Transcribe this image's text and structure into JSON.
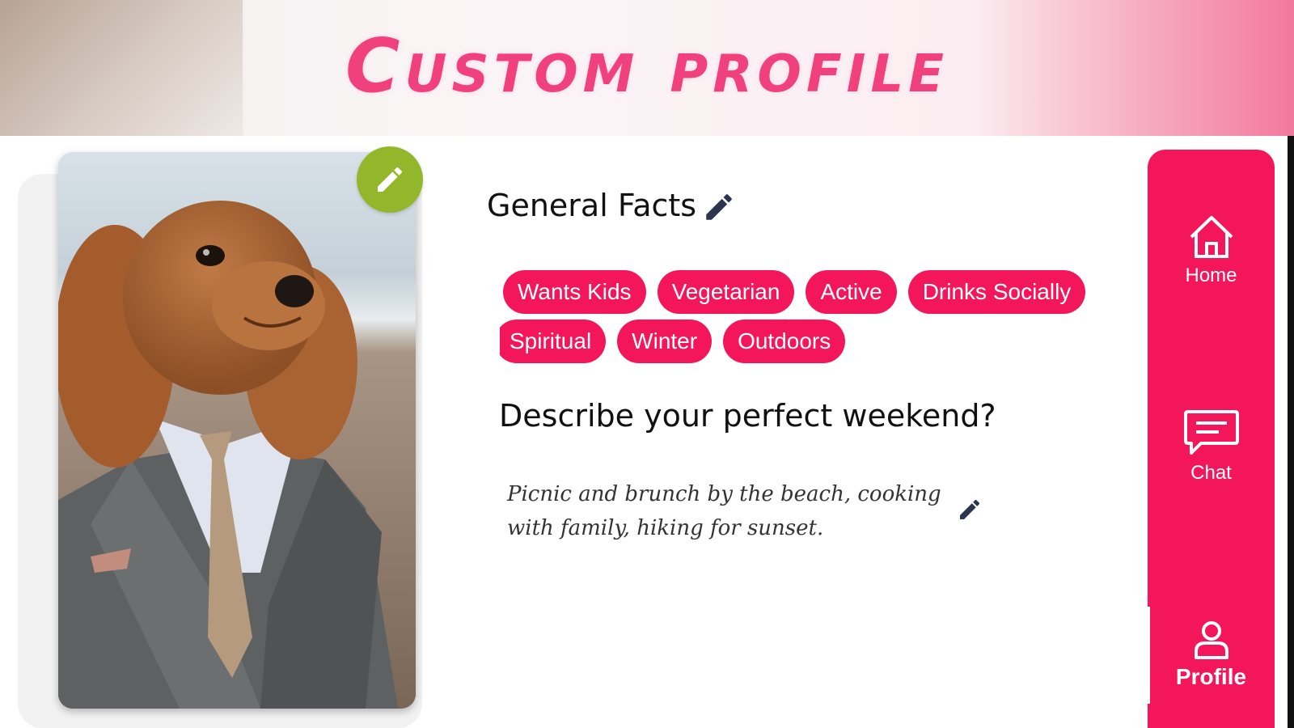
{
  "header": {
    "title": "Custom profile"
  },
  "photo": {
    "alt": "dog wearing a suit and tie",
    "edit_icon": "pencil-icon"
  },
  "general_facts": {
    "title": "General Facts",
    "edit_icon": "pencil-icon",
    "tags": [
      "Wants Kids",
      "Vegetarian",
      "Active",
      "Drinks Socially",
      "Spiritual",
      "Winter",
      "Outdoors"
    ]
  },
  "prompt": {
    "question": "Describe your perfect weekend?",
    "answer": "Picnic and brunch by the beach, cooking with family, hiking for sunset.",
    "edit_icon": "pencil-icon"
  },
  "nav": {
    "home": {
      "label": "Home",
      "icon": "home-icon"
    },
    "chat": {
      "label": "Chat",
      "icon": "chat-icon"
    },
    "profile": {
      "label": "Profile",
      "icon": "user-icon"
    }
  },
  "colors": {
    "accent": "#f4165a",
    "title_pink": "#f0417d",
    "edit_green": "#93b72a",
    "text_dark": "#111111"
  }
}
